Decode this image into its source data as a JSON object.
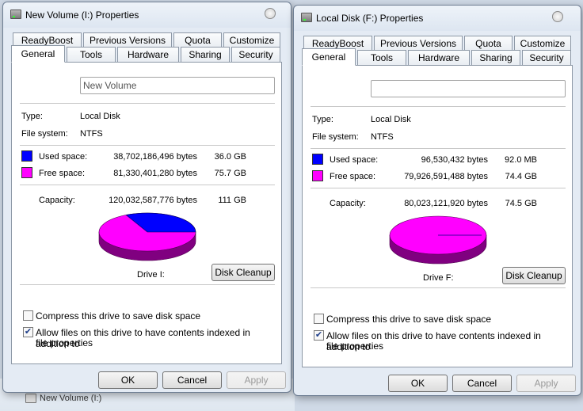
{
  "background": {
    "item_label": "New Volume (I:)"
  },
  "windows": [
    {
      "title": "New Volume (I:) Properties",
      "tabs_row1": [
        "ReadyBoost",
        "Previous Versions",
        "Quota",
        "Customize"
      ],
      "tabs_row2": [
        "General",
        "Tools",
        "Hardware",
        "Sharing",
        "Security"
      ],
      "active_tab": "General",
      "name_value": "New Volume",
      "type_label": "Type:",
      "type_value": "Local Disk",
      "fs_label": "File system:",
      "fs_value": "NTFS",
      "used_label": "Used space:",
      "used_bytes": "38,702,186,496 bytes",
      "used_size": "36.0 GB",
      "free_label": "Free space:",
      "free_bytes": "81,330,401,280 bytes",
      "free_size": "75.7 GB",
      "capacity_label": "Capacity:",
      "capacity_bytes": "120,032,587,776 bytes",
      "capacity_size": "111 GB",
      "used_fraction": 0.3224,
      "drive_label": "Drive I:",
      "cleanup_label": "Disk Cleanup",
      "compress_label": "Compress this drive to save disk space",
      "compress_checked": false,
      "index_label_1": "Allow files on this drive to have contents indexed in addition to",
      "index_label_2": "file properties",
      "index_checked": true,
      "ok_label": "OK",
      "cancel_label": "Cancel",
      "apply_label": "Apply"
    },
    {
      "title": "Local Disk (F:) Properties",
      "tabs_row1": [
        "ReadyBoost",
        "Previous Versions",
        "Quota",
        "Customize"
      ],
      "tabs_row2": [
        "General",
        "Tools",
        "Hardware",
        "Sharing",
        "Security"
      ],
      "active_tab": "General",
      "name_value": "",
      "type_label": "Type:",
      "type_value": "Local Disk",
      "fs_label": "File system:",
      "fs_value": "NTFS",
      "used_label": "Used space:",
      "used_bytes": "96,530,432 bytes",
      "used_size": "92.0 MB",
      "free_label": "Free space:",
      "free_bytes": "79,926,591,488 bytes",
      "free_size": "74.4 GB",
      "capacity_label": "Capacity:",
      "capacity_bytes": "80,023,121,920 bytes",
      "capacity_size": "74.5 GB",
      "used_fraction": 0.0012,
      "drive_label": "Drive F:",
      "cleanup_label": "Disk Cleanup",
      "compress_label": "Compress this drive to save disk space",
      "compress_checked": false,
      "index_label_1": "Allow files on this drive to have contents indexed in addition to",
      "index_label_2": "file properties",
      "index_checked": true,
      "ok_label": "OK",
      "cancel_label": "Cancel",
      "apply_label": "Apply"
    }
  ],
  "colors": {
    "used": "#0000ff",
    "used_side": "#000080",
    "free": "#ff00ff",
    "free_side": "#800080"
  }
}
